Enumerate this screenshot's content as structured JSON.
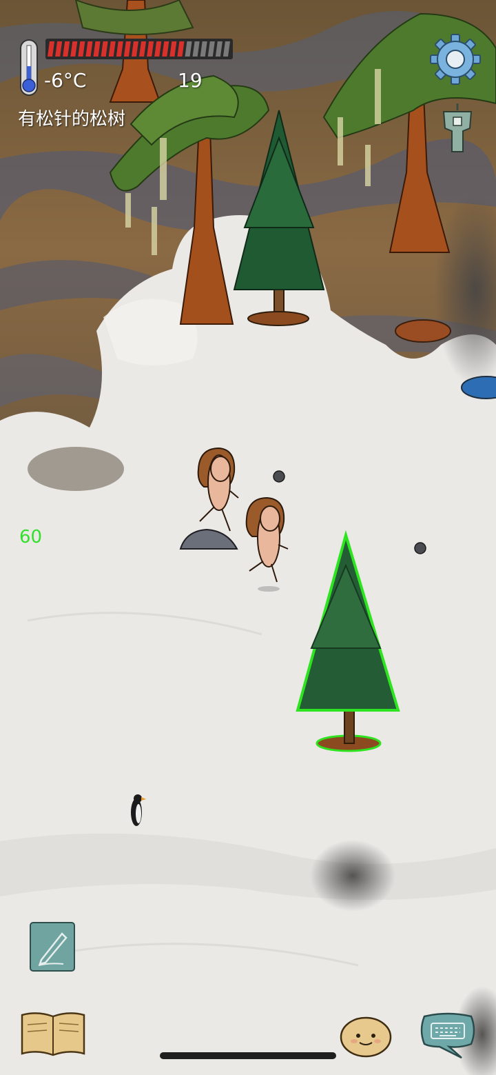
{
  "hud": {
    "temperature": "-6°C",
    "health_fraction": 0.75,
    "count": "19",
    "hover_label": "有松针的松树",
    "fps": "60"
  },
  "colors": {
    "health_red": "#d8302a",
    "health_empty": "#7a7a7a",
    "highlight_green": "#2ee31f",
    "fps_green": "#31e02a"
  },
  "icons": {
    "settings": "gear-icon",
    "amulet": "amulet-icon",
    "edit": "pencil-icon",
    "tech": "book-icon",
    "emote": "face-icon",
    "chat": "keyboard-icon"
  }
}
